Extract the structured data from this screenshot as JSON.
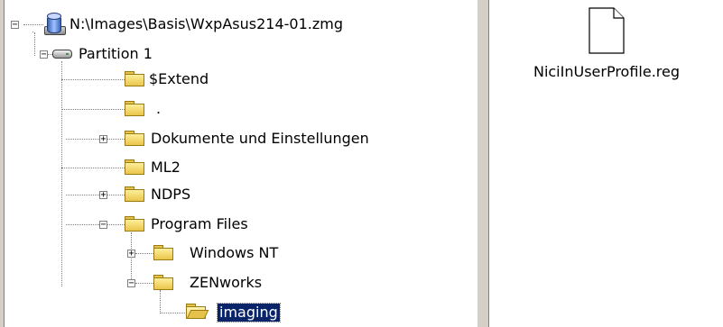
{
  "tree": {
    "root_path": "N:\\Images\\Basis\\WxpAsus214-01.zmg",
    "partition_label": "Partition 1",
    "folders": {
      "extend": "$Extend",
      "dot": ".",
      "dokumente": "Dokumente und Einstellungen",
      "ml2": "ML2",
      "ndps": "NDPS",
      "program_files": "Program Files",
      "windows_nt": "Windows NT",
      "zenworks": "ZENworks",
      "imaging": "imaging"
    },
    "selected": "imaging"
  },
  "files": {
    "items": [
      {
        "name": "NiciInUserProfile.reg",
        "icon": "document-icon"
      }
    ]
  },
  "colors": {
    "selection_bg": "#0a246a",
    "selection_text": "#ffffff",
    "chrome": "#d4d0c8",
    "folder": "#e9c54b"
  }
}
